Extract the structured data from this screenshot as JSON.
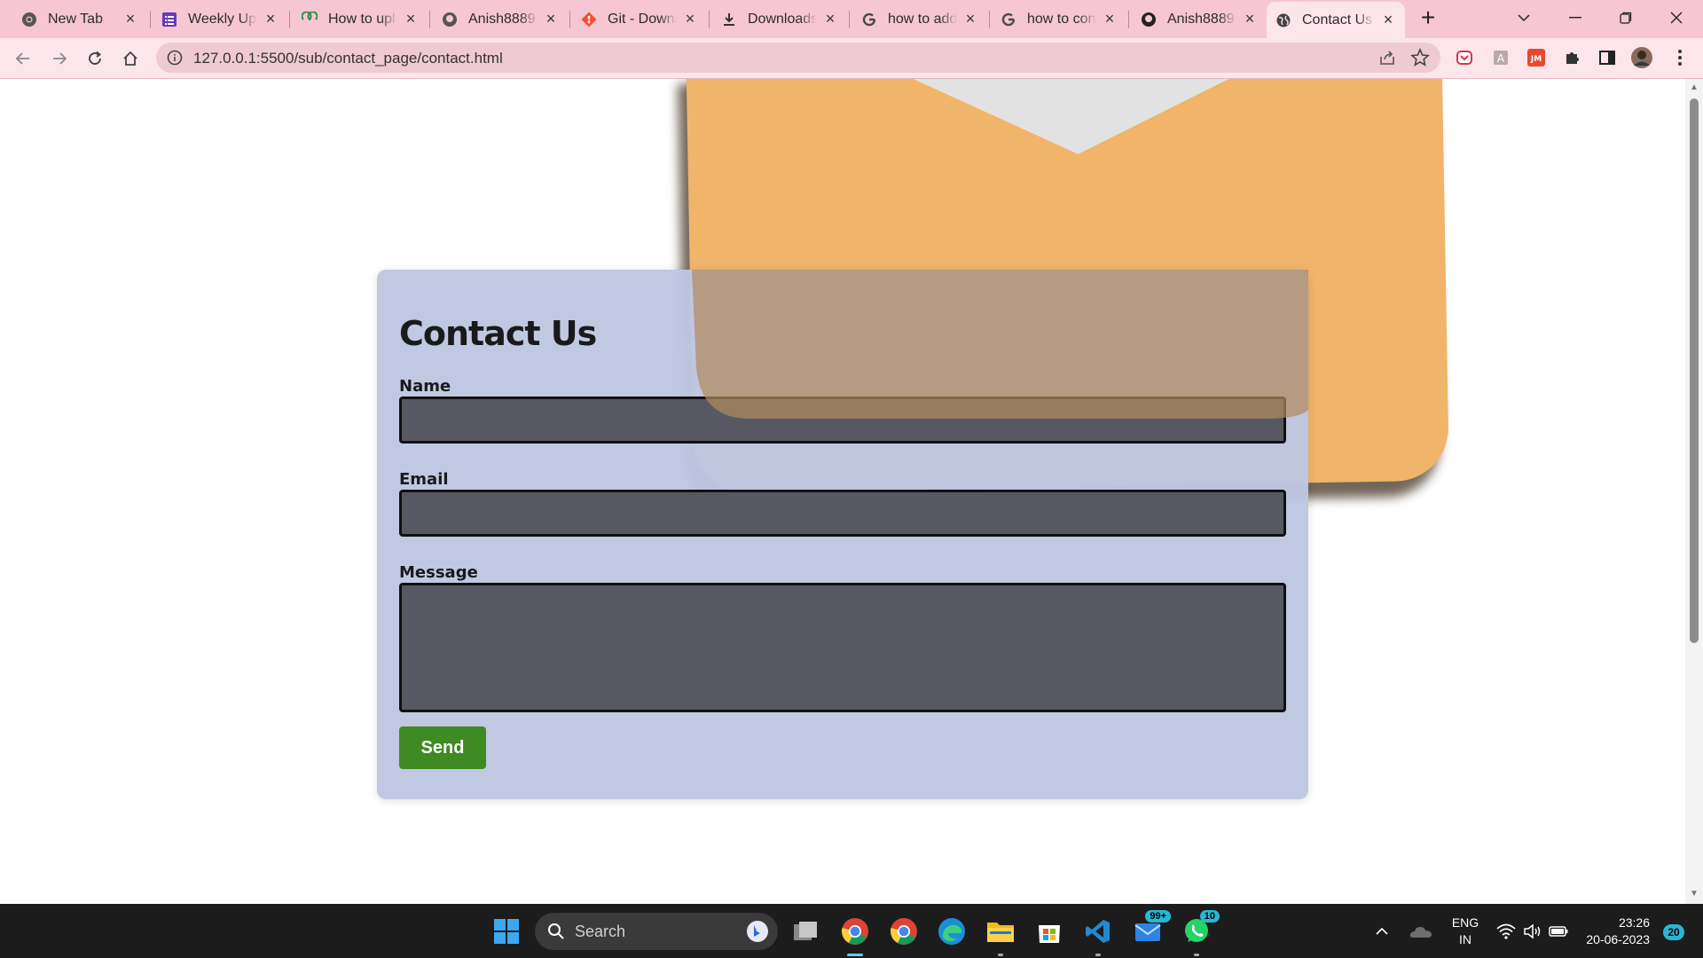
{
  "browser": {
    "tabs": [
      {
        "title": "New Tab",
        "icon": "chrome-icon"
      },
      {
        "title": "Weekly Upc",
        "icon": "forms-icon"
      },
      {
        "title": "How to upl",
        "icon": "geeks-icon"
      },
      {
        "title": "Anish8889",
        "icon": "github-icon"
      },
      {
        "title": "Git - Downl",
        "icon": "git-icon"
      },
      {
        "title": "Downloads",
        "icon": "download-icon"
      },
      {
        "title": "how to add",
        "icon": "google-icon"
      },
      {
        "title": "how to con",
        "icon": "google-icon"
      },
      {
        "title": "Anish8889",
        "icon": "github-icon"
      },
      {
        "title": "Contact Us",
        "icon": "globe-icon",
        "active": true
      }
    ],
    "new_tab": "+",
    "url": "127.0.0.1:5500/sub/contact_page/contact.html"
  },
  "page": {
    "title": "Contact Us",
    "name_label": "Name",
    "email_label": "Email",
    "message_label": "Message",
    "send_label": "Send",
    "colors": {
      "card": "#bec6e1",
      "field": "#575862",
      "button": "#3f8a23",
      "envelope": "#f0b56a"
    }
  },
  "taskbar": {
    "search_text": "Search",
    "mail_badge": "99+",
    "whatsapp_badge": "10",
    "lang": "ENG",
    "region": "IN",
    "time": "23:26",
    "date": "20-06-2023",
    "notification_count": "20"
  }
}
